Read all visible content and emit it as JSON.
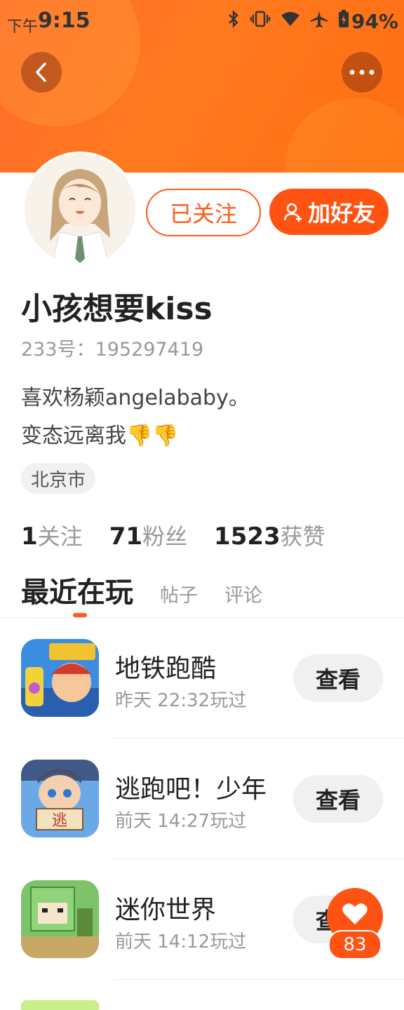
{
  "status_bar": {
    "time_prefix": "下午",
    "time": "9:15",
    "battery": "94%",
    "icons": [
      "bluetooth-icon",
      "vibrate-icon",
      "wifi-icon",
      "airplane-icon",
      "battery-icon"
    ]
  },
  "profile": {
    "followed_label": "已关注",
    "add_friend_label": "加好友",
    "username": "小孩想要kiss",
    "user_id": "233号：195297419",
    "bio_line1": "喜欢杨颖angelababy。",
    "bio_line2": "变态远离我👎👎",
    "location": "北京市",
    "stats": {
      "following_count": "1",
      "following_label": "关注",
      "fans_count": "71",
      "fans_label": "粉丝",
      "likes_count": "1523",
      "likes_label": "获赞"
    }
  },
  "tabs": [
    "最近在玩",
    "帖子",
    "评论"
  ],
  "games": [
    {
      "name": "地铁跑酷",
      "time": "昨天 22:32玩过",
      "button": "查看"
    },
    {
      "name": "逃跑吧！少年",
      "time": "前天 14:27玩过",
      "button": "查看"
    },
    {
      "name": "迷你世界",
      "time": "前天 14:12玩过",
      "button": "查看"
    }
  ],
  "like_fab": {
    "count": "83"
  },
  "colors": {
    "accent": "#ff5313",
    "banner": "#ff7a1f"
  }
}
